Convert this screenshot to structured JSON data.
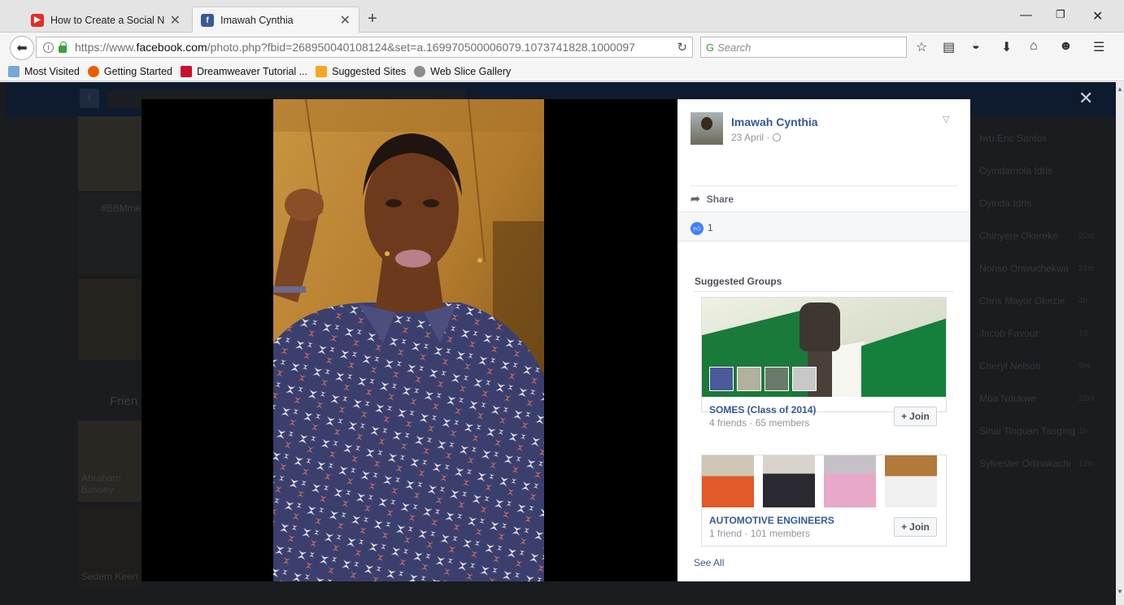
{
  "browser": {
    "tabs": [
      {
        "title": "How to Create a Social Ne...",
        "icon": "youtube-icon",
        "active": false
      },
      {
        "title": "Imawah Cynthia",
        "icon": "facebook-icon",
        "active": true
      }
    ],
    "url_prefix": "https://www.",
    "url_domain": "facebook.com",
    "url_rest": "/photo.php?fbid=268950040108124&set=a.169970500006079.1073741828.1000097",
    "search_placeholder": "Search",
    "bookmarks": [
      "Most Visited",
      "Getting Started",
      "Dreamweaver Tutorial ...",
      "Suggested Sites",
      "Web Slice Gallery"
    ]
  },
  "background_page": {
    "chat_list": [
      {
        "name": "Iwu Eric Santos",
        "time": ""
      },
      {
        "name": "Oyindamola Idris",
        "time": ""
      },
      {
        "name": "Oyinda Idris",
        "time": ""
      },
      {
        "name": "Chinyere Okereke",
        "time": "20m"
      },
      {
        "name": "Nonso Onwuchekwa",
        "time": "21m"
      },
      {
        "name": "Chris Mayor Okezie",
        "time": "4h"
      },
      {
        "name": "Jacob Favour",
        "time": "1d"
      },
      {
        "name": "Cheryl Nelson",
        "time": "9m"
      },
      {
        "name": "Mba Ndukwe",
        "time": "22m"
      },
      {
        "name": "Sinai Tinguan Tanging",
        "time": "1h"
      },
      {
        "name": "Sylvester Odinakachi",
        "time": "12m"
      }
    ],
    "friends_label": "Frien",
    "friend_names": [
      "Abraham Bassey",
      "Sedem Keen"
    ],
    "left_text": "#BBMme"
  },
  "post": {
    "poster_name": "Imawah Cynthia",
    "date": "23 April ·",
    "share_label": "Share",
    "like_count": "1"
  },
  "suggested_groups": {
    "title": "Suggested Groups",
    "groups": [
      {
        "name": "SOMES (Class of 2014)",
        "meta": "4 friends · 65 members",
        "join_label": "Join"
      },
      {
        "name": "AUTOMOTIVE ENGINEERS",
        "meta": "1 friend · 101 members",
        "join_label": "Join"
      }
    ],
    "see_all": "See All"
  },
  "colors": {
    "link_blue": "#365899",
    "facebook_blue": "#3b5998",
    "like_blue": "#4080ff",
    "photo_bg": "#000000"
  }
}
